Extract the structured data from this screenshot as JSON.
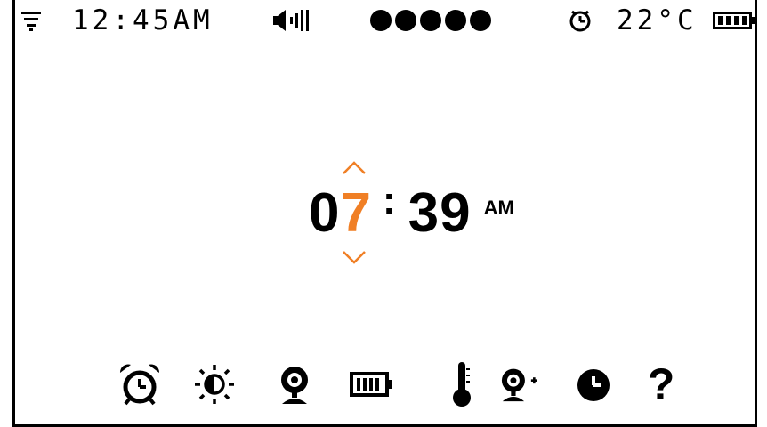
{
  "status_bar": {
    "time": "12:45AM",
    "temperature": "22°C",
    "signal_level": 5,
    "battery_level": 1.0
  },
  "time_setter": {
    "hour_first_digit": "0",
    "hour_second_digit": "7",
    "colon": ":",
    "minutes": "39",
    "meridiem": "AM",
    "accent_color": "#f07f25"
  },
  "icon_menu": {
    "items": [
      {
        "icon": "alarm-clock-icon"
      },
      {
        "icon": "brightness-icon"
      },
      {
        "icon": "camera-icon"
      },
      {
        "icon": "battery-icon"
      },
      {
        "icon": "thermometer-icon"
      },
      {
        "icon": "add-camera-icon"
      },
      {
        "icon": "clock-icon"
      },
      {
        "icon": "help-icon",
        "glyph": "?"
      }
    ]
  }
}
